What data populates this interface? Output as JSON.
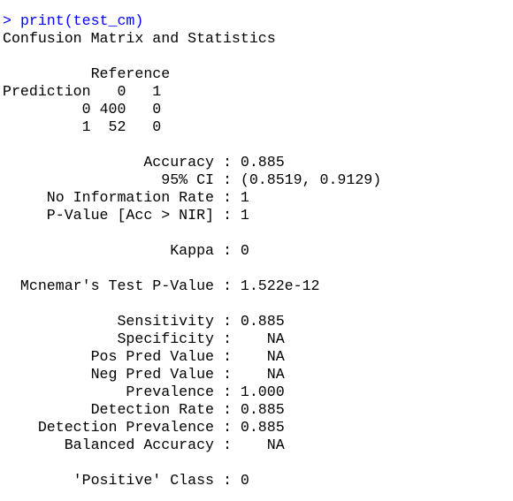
{
  "console": {
    "prompt": ">",
    "command": "print(test_cm)",
    "title": "Confusion Matrix and Statistics",
    "matrix": {
      "reference_label": "Reference",
      "prediction_label": "Prediction",
      "col_header": "0   1",
      "rows": [
        {
          "label": "0",
          "cells": "400   0"
        },
        {
          "label": "1",
          "cells": "52   0"
        }
      ]
    },
    "stats": [
      {
        "label": "Accuracy",
        "value": "0.885"
      },
      {
        "label": "95% CI",
        "value": "(0.8519, 0.9129)"
      },
      {
        "label": "No Information Rate",
        "value": "1"
      },
      {
        "label": "P-Value [Acc > NIR]",
        "value": "1"
      },
      {
        "label": "Kappa",
        "value": "0"
      },
      {
        "label": "Mcnemar's Test P-Value",
        "value": "1.522e-12"
      },
      {
        "label": "Sensitivity",
        "value": "0.885"
      },
      {
        "label": "Specificity",
        "value": "NA"
      },
      {
        "label": "Pos Pred Value",
        "value": "NA"
      },
      {
        "label": "Neg Pred Value",
        "value": "NA"
      },
      {
        "label": "Prevalence",
        "value": "1.000"
      },
      {
        "label": "Detection Rate",
        "value": "0.885"
      },
      {
        "label": "Detection Prevalence",
        "value": "0.885"
      },
      {
        "label": "Balanced Accuracy",
        "value": "NA"
      },
      {
        "label": "'Positive' Class",
        "value": "0"
      }
    ]
  }
}
